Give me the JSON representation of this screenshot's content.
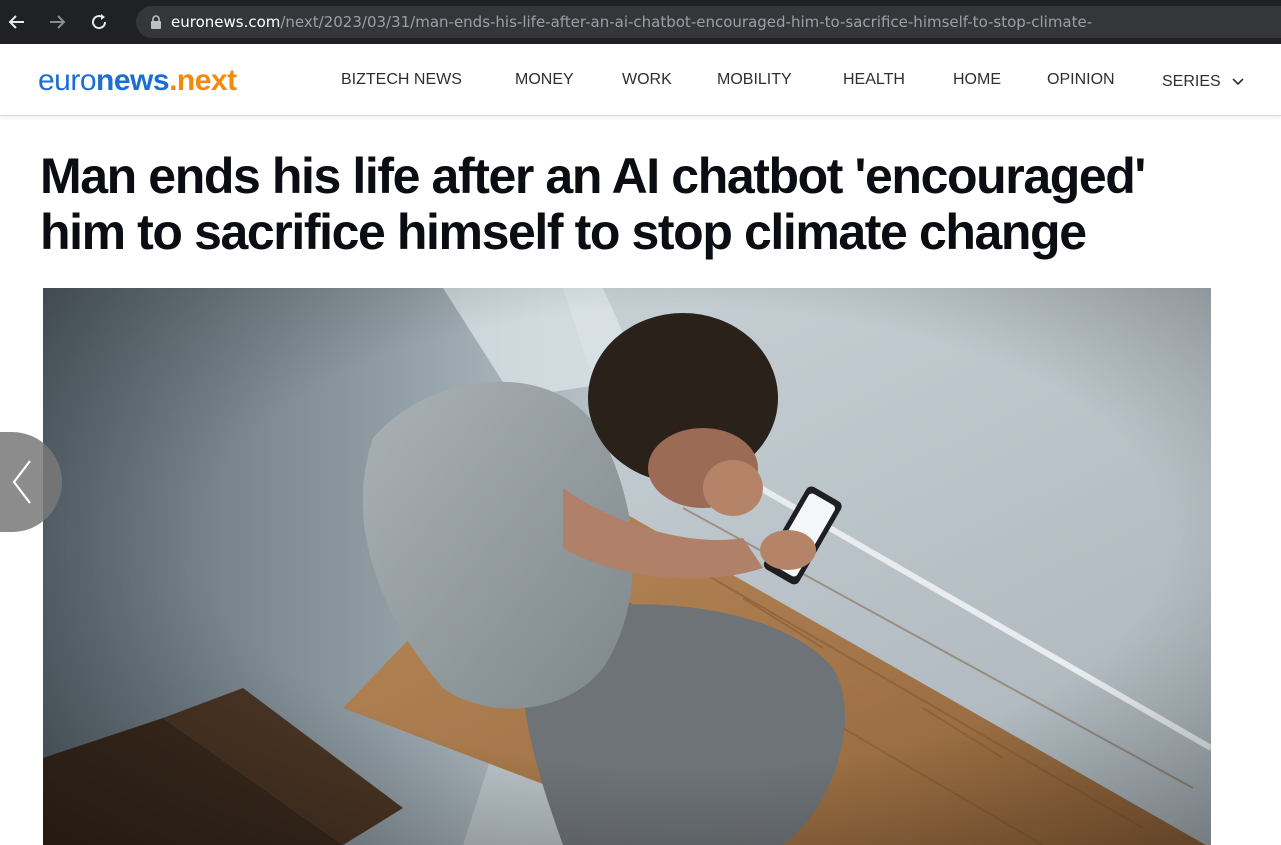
{
  "browser": {
    "url_host": "euronews.com",
    "url_path": "/next/2023/03/31/man-ends-his-life-after-an-ai-chatbot-encouraged-him-to-sacrifice-himself-to-stop-climate-",
    "icons": [
      "back-icon",
      "forward-icon",
      "reload-icon",
      "lock-icon"
    ]
  },
  "site": {
    "logo": {
      "part1": "euro",
      "part2": "news",
      "part3": ".",
      "part4": "next"
    },
    "nav": [
      {
        "label": "BIZTECH NEWS"
      },
      {
        "label": "MONEY"
      },
      {
        "label": "WORK"
      },
      {
        "label": "MOBILITY"
      },
      {
        "label": "HEALTH"
      },
      {
        "label": "HOME"
      },
      {
        "label": "OPINION"
      },
      {
        "label": "SERIES"
      }
    ],
    "colors": {
      "brand_blue": "#1b6fd2",
      "brand_orange": "#f28b0c"
    }
  },
  "article": {
    "headline": "Man ends his life after an AI chatbot 'encouraged' him to sacrifice himself to stop climate change"
  },
  "carousel": {
    "prev_icon": "chevron-left-icon"
  }
}
